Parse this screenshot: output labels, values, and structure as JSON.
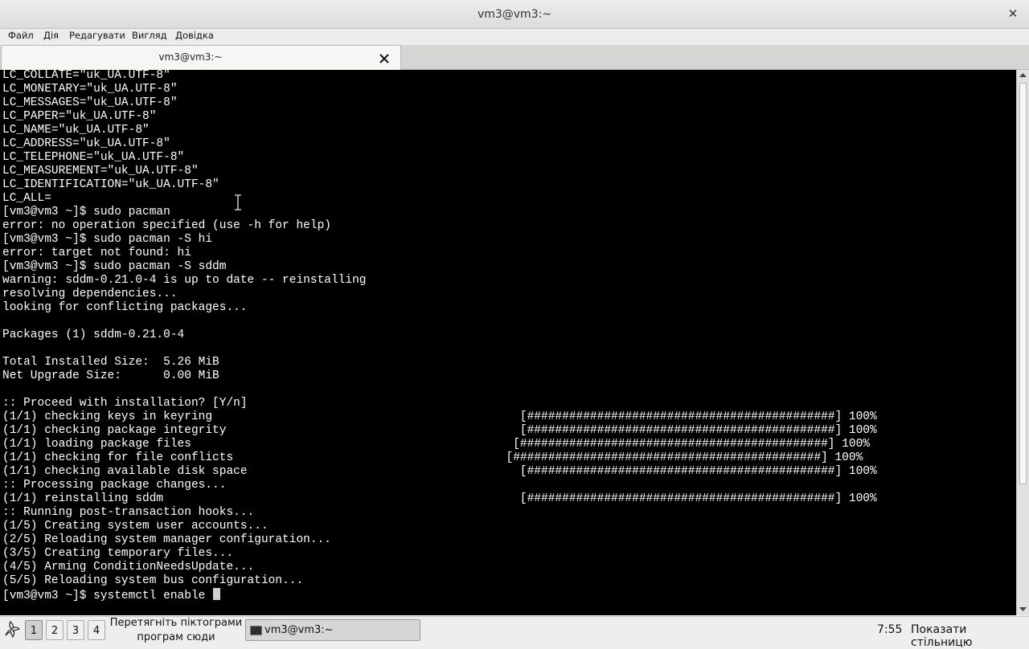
{
  "window": {
    "title": "vm3@vm3:~"
  },
  "menu": {
    "items": [
      "Файл",
      "Дія",
      "Редагувати",
      "Вигляд",
      "Довідка"
    ]
  },
  "tab": {
    "label": "vm3@vm3:~"
  },
  "terminal": {
    "lines": [
      "LC_COLLATE=\"uk_UA.UTF-8\"",
      "LC_MONETARY=\"uk_UA.UTF-8\"",
      "LC_MESSAGES=\"uk_UA.UTF-8\"",
      "LC_PAPER=\"uk_UA.UTF-8\"",
      "LC_NAME=\"uk_UA.UTF-8\"",
      "LC_ADDRESS=\"uk_UA.UTF-8\"",
      "LC_TELEPHONE=\"uk_UA.UTF-8\"",
      "LC_MEASUREMENT=\"uk_UA.UTF-8\"",
      "LC_IDENTIFICATION=\"uk_UA.UTF-8\"",
      "LC_ALL=",
      "[vm3@vm3 ~]$ sudo pacman",
      "error: no operation specified (use -h for help)",
      "[vm3@vm3 ~]$ sudo pacman -S hi",
      "error: target not found: hi",
      "[vm3@vm3 ~]$ sudo pacman -S sddm",
      "warning: sddm-0.21.0-4 is up to date -- reinstalling",
      "resolving dependencies...",
      "looking for conflicting packages...",
      "",
      "Packages (1) sddm-0.21.0-4",
      "",
      "Total Installed Size:  5.26 MiB",
      "Net Upgrade Size:      0.00 MiB",
      "",
      ":: Proceed with installation? [Y/n]",
      "(1/1) checking keys in keyring                                            [############################################] 100%",
      "(1/1) checking package integrity                                          [############################################] 100%",
      "(1/1) loading package files                                              [############################################] 100%",
      "(1/1) checking for file conflicts                                       [############################################] 100%",
      "(1/1) checking available disk space                                       [############################################] 100%",
      ":: Processing package changes...",
      "(1/1) reinstalling sddm                                                   [############################################] 100%",
      ":: Running post-transaction hooks...",
      "(1/5) Creating system user accounts...",
      "(2/5) Reloading system manager configuration...",
      "(3/5) Creating temporary files...",
      "(4/5) Arming ConditionNeedsUpdate...",
      "(5/5) Reloading system bus configuration...",
      "[vm3@vm3 ~]$ systemctl enable "
    ]
  },
  "taskbar": {
    "workspaces": [
      "1",
      "2",
      "3",
      "4"
    ],
    "active_workspace": "1",
    "drop_hint_line1": "Перетягніть піктограми",
    "drop_hint_line2": "програм сюди",
    "task_label": "vm3@vm3:~",
    "clock": "7:55",
    "show_desktop": "Показати стільницю"
  },
  "icons": {
    "close": "close-icon",
    "tab_close": "tab-close-icon",
    "start_menu": "app-menu-icon",
    "task": "terminal-icon"
  }
}
